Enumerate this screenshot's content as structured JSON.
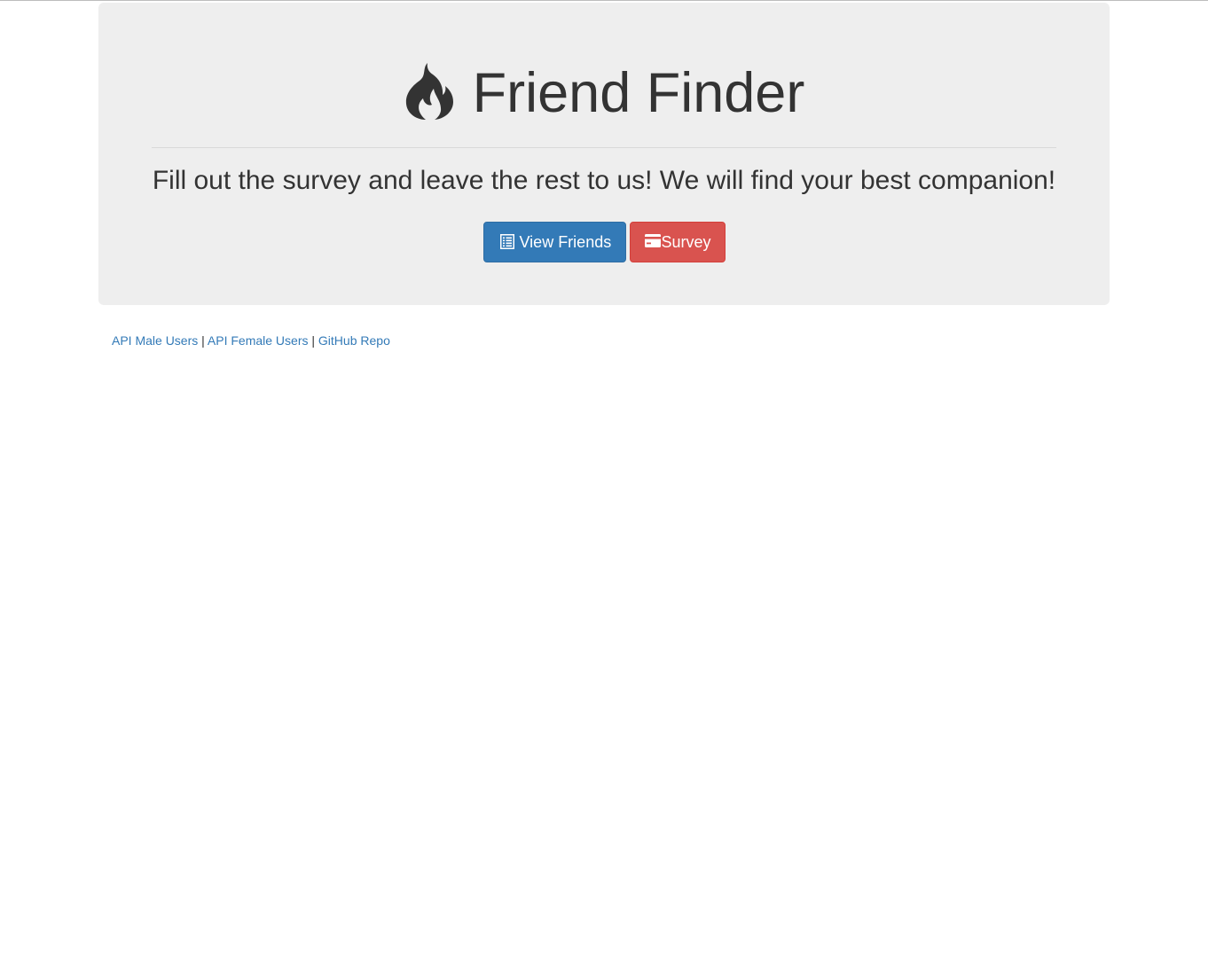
{
  "header": {
    "title": "Friend Finder",
    "title_icon": "flame-icon",
    "subtitle": "Fill out the survey and leave the rest to us! We will find your best companion!"
  },
  "buttons": {
    "view_friends": {
      "label": "View Friends",
      "icon": "list-icon",
      "color": "#337ab7"
    },
    "survey": {
      "label": "Survey",
      "icon": "credit-card-icon",
      "color": "#d9534f"
    }
  },
  "footer": {
    "links": [
      {
        "label": "API Male Users"
      },
      {
        "label": "API Female Users"
      },
      {
        "label": "GitHub Repo"
      }
    ],
    "separator": "|"
  },
  "colors": {
    "jumbotron_bg": "#eeeeee",
    "text": "#333333",
    "link": "#337ab7"
  }
}
